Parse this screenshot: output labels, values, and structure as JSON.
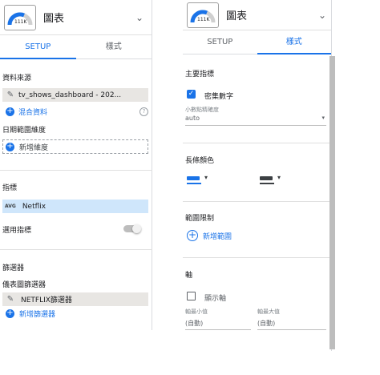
{
  "left": {
    "title": "圖表",
    "gauge_text": "111K",
    "tabs": {
      "setup": "SETUP",
      "style": "樣式"
    },
    "data_source": {
      "heading": "資料來源",
      "source_name": "tv_shows_dashboard - 202...",
      "merge_label": "混合資料",
      "help_icon": "?"
    },
    "date_range": {
      "heading": "日期範圍維度",
      "add_label": "新增維度"
    },
    "metric": {
      "heading": "指標",
      "agg": "AVG",
      "field": "Netflix",
      "optional_label": "選用指標"
    },
    "filter": {
      "heading": "篩選器",
      "sub_heading": "儀表圖篩選器",
      "chip_label": "NETFLIX篩選器",
      "add_label": "新增篩選器"
    }
  },
  "right": {
    "title": "圖表",
    "gauge_text": "111K",
    "tabs": {
      "setup": "SETUP",
      "style": "樣式"
    },
    "primary_metric": {
      "heading": "主要指標",
      "compact_label": "密集數字",
      "compact_checked": true,
      "decimal_label": "小數點精確度",
      "decimal_value": "auto"
    },
    "bar_colors": {
      "heading": "長條顏色",
      "color1": "#1a73e8",
      "color2": "#3c4043"
    },
    "range_limits": {
      "heading": "範圍限制",
      "add_label": "新增範圍"
    },
    "axis": {
      "heading": "軸",
      "show_label": "顯示軸",
      "min_label": "軸最小值",
      "max_label": "軸最大值",
      "min_value": "(自動)",
      "max_value": "(自動)"
    }
  }
}
